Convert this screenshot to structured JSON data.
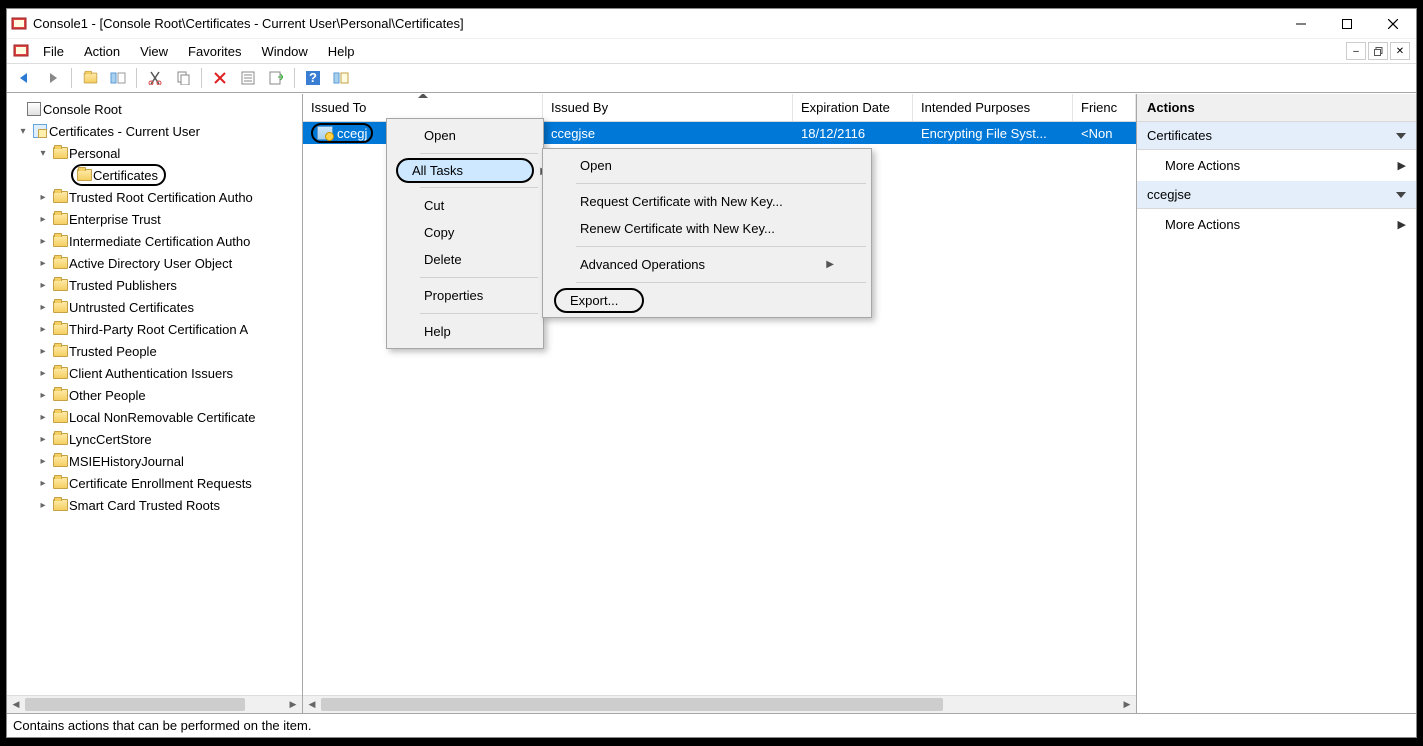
{
  "titlebar": {
    "title": "Console1 - [Console Root\\Certificates - Current User\\Personal\\Certificates]"
  },
  "menubar": {
    "items": [
      "File",
      "Action",
      "View",
      "Favorites",
      "Window",
      "Help"
    ]
  },
  "tree": {
    "root": "Console Root",
    "certs_node": "Certificates - Current User",
    "personal": "Personal",
    "certificates": "Certificates",
    "others": [
      "Trusted Root Certification Autho",
      "Enterprise Trust",
      "Intermediate Certification Autho",
      "Active Directory User Object",
      "Trusted Publishers",
      "Untrusted Certificates",
      "Third-Party Root Certification A",
      "Trusted People",
      "Client Authentication Issuers",
      "Other People",
      "Local NonRemovable Certificate",
      "LyncCertStore",
      "MSIEHistoryJournal",
      "Certificate Enrollment Requests",
      "Smart Card Trusted Roots"
    ]
  },
  "list": {
    "headers": {
      "issued_to": "Issued To",
      "issued_by": "Issued By",
      "expiration": "Expiration Date",
      "intended": "Intended Purposes",
      "friendly": "Frienc"
    },
    "row": {
      "issued_to": "ccegj",
      "issued_by": "ccegjse",
      "expiration": "18/12/2116",
      "intended": "Encrypting File Syst...",
      "friendly": "<Non"
    }
  },
  "ctx1": {
    "open": "Open",
    "all_tasks": "All Tasks",
    "cut": "Cut",
    "copy": "Copy",
    "delete": "Delete",
    "properties": "Properties",
    "help": "Help"
  },
  "ctx2": {
    "open": "Open",
    "req_new": "Request Certificate with New Key...",
    "renew_new": "Renew Certificate with New Key...",
    "adv_ops": "Advanced Operations",
    "export": "Export..."
  },
  "actions": {
    "header": "Actions",
    "sect1": "Certificates",
    "more1": "More Actions",
    "sect2": "ccegjse",
    "more2": "More Actions"
  },
  "status": "Contains actions that can be performed on the item."
}
